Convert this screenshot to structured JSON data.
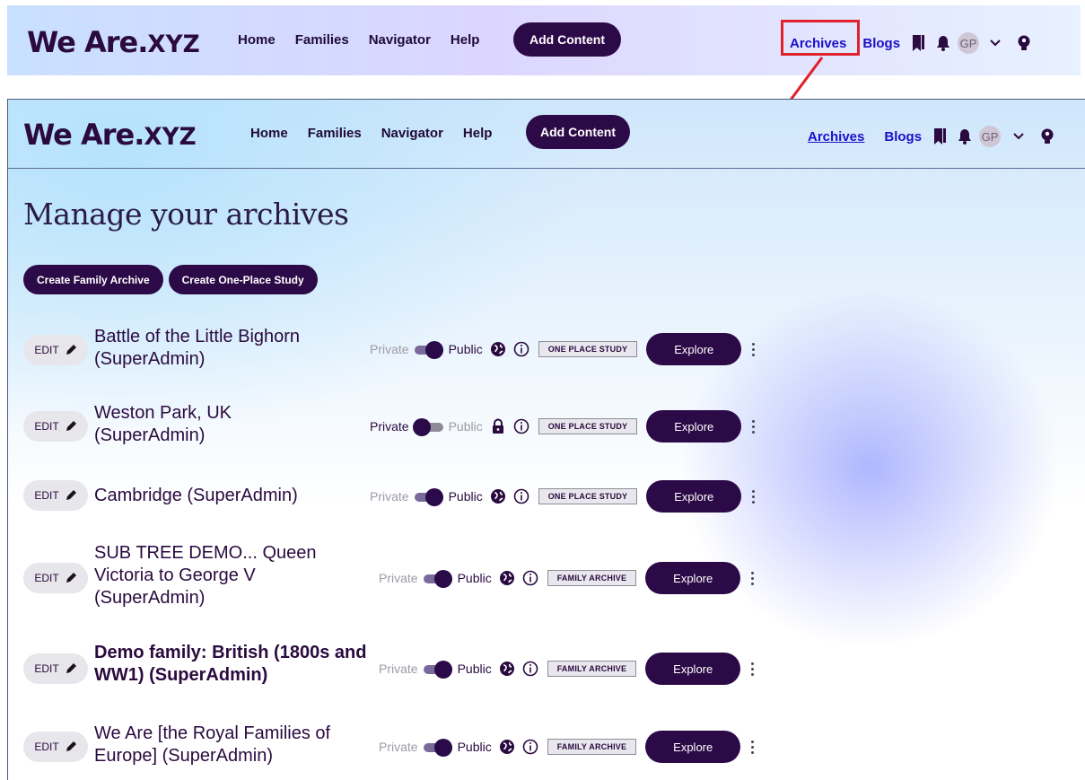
{
  "header": {
    "logo_main": "We Are.",
    "logo_xyz": "XYZ",
    "nav": [
      "Home",
      "Families",
      "Navigator",
      "Help"
    ],
    "add_content": "Add Content",
    "archives": "Archives",
    "blogs": "Blogs",
    "avatar_initials": "GP"
  },
  "page": {
    "title": "Manage your archives",
    "create_family": "Create Family Archive",
    "create_ops": "Create One-Place Study"
  },
  "archives": [
    {
      "edit": "EDIT",
      "title": "Battle of the Little Bighorn (SuperAdmin)",
      "private": "Private",
      "public": "Public",
      "visibility": "public",
      "type": "ONE PLACE STUDY",
      "explore": "Explore"
    },
    {
      "edit": "EDIT",
      "title": "Weston Park, UK (SuperAdmin)",
      "private": "Private",
      "public": "Public",
      "visibility": "private",
      "type": "ONE PLACE STUDY",
      "explore": "Explore"
    },
    {
      "edit": "EDIT",
      "title": "Cambridge (SuperAdmin)",
      "private": "Private",
      "public": "Public",
      "visibility": "public",
      "type": "ONE PLACE STUDY",
      "explore": "Explore"
    },
    {
      "edit": "EDIT",
      "title": "SUB TREE DEMO... Queen Victoria to George V (SuperAdmin)",
      "private": "Private",
      "public": "Public",
      "visibility": "public",
      "type": "FAMILY ARCHIVE",
      "explore": "Explore"
    },
    {
      "edit": "EDIT",
      "title": "Demo family: British (1800s and WW1) (SuperAdmin)",
      "private": "Private",
      "public": "Public",
      "visibility": "public",
      "type": "FAMILY ARCHIVE",
      "explore": "Explore"
    },
    {
      "edit": "EDIT",
      "title": "We Are [the Royal Families of Europe] (SuperAdmin)",
      "private": "Private",
      "public": "Public",
      "visibility": "public",
      "type": "FAMILY ARCHIVE",
      "explore": "Explore"
    }
  ],
  "colors": {
    "brand": "#2c0a47",
    "link": "#1a10c7",
    "callout": "#e0202a"
  },
  "icons": [
    "pencil-icon",
    "globe-icon",
    "lock-icon",
    "info-icon",
    "bookmark-icon",
    "bell-icon",
    "chevron-down-icon",
    "lightbulb-icon",
    "kebab-menu-icon"
  ]
}
